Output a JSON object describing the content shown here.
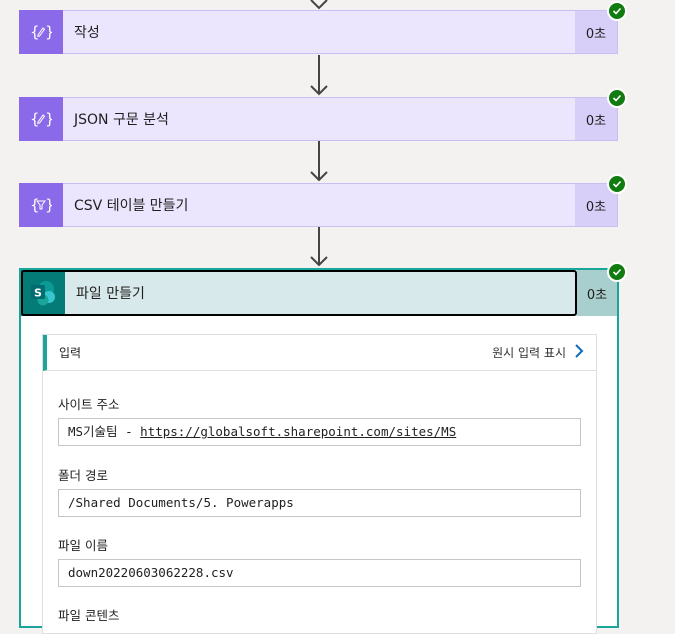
{
  "steps": [
    {
      "title": "작성",
      "duration": "0초",
      "icon": "braces-pencil-icon"
    },
    {
      "title": "JSON 구문 분석",
      "duration": "0초",
      "icon": "braces-pencil-icon"
    },
    {
      "title": "CSV 테이블 만들기",
      "duration": "0초",
      "icon": "braces-filter-icon"
    }
  ],
  "active_step": {
    "title": "파일 만들기",
    "duration": "0초",
    "icon": "sharepoint-icon",
    "icon_letter": "S",
    "inputs_label": "입력",
    "raw_inputs_label": "원시 입력 표시",
    "fields": [
      {
        "label": "사이트 주소",
        "value_prefix": "MS기술팀 - ",
        "value_link": "https://globalsoft.sharepoint.com/sites/MS"
      },
      {
        "label": "폴더 경로",
        "value": "/Shared Documents/5. Powerapps"
      },
      {
        "label": "파일 이름",
        "value": "down20220603062228.csv"
      },
      {
        "label": "파일 콘텐츠"
      }
    ]
  },
  "colors": {
    "action_purple": "#8a6ae8",
    "action_bg": "#ebe5fe",
    "sharepoint_teal": "#057b78",
    "success_green": "#107c10"
  }
}
